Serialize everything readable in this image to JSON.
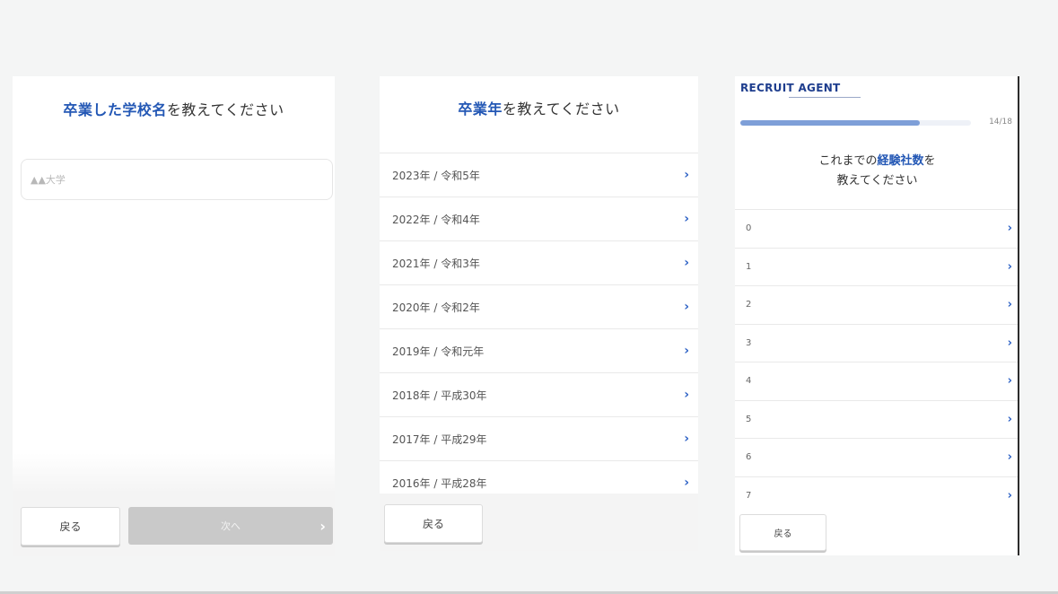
{
  "screen1": {
    "title_highlight": "卒業した学校名",
    "title_rest": "を教えてください",
    "school_input": {
      "value": "",
      "placeholder": "▲▲大学"
    },
    "back_label": "戻る",
    "next_label": "次へ",
    "next_chevron": "›"
  },
  "screen2": {
    "title_highlight": "卒業年",
    "title_rest": "を教えてください",
    "years": [
      "2023年 / 令和5年",
      "2022年 / 令和4年",
      "2021年 / 令和3年",
      "2020年 / 令和2年",
      "2019年 / 令和元年",
      "2018年 / 平成30年",
      "2017年 / 平成29年",
      "2016年 / 平成28年"
    ],
    "row_chevron": "›",
    "back_label": "戻る"
  },
  "screen3": {
    "logo_text": "RECRUIT AGENT",
    "progress": {
      "current": 14,
      "total": 18,
      "text": "14/18"
    },
    "title_prefix": "これまでの",
    "title_highlight": "経験社数",
    "title_suffix": "を",
    "title_line2": "教えてください",
    "options": [
      "0",
      "1",
      "2",
      "3",
      "4",
      "5",
      "6",
      "7"
    ],
    "row_chevron": "›",
    "back_label": "戻る"
  },
  "colors": {
    "accent": "#2458b5",
    "chevron": "#2f63c6",
    "progress_fill": "#7e9fd8",
    "disabled_button": "#c9c9c9"
  }
}
